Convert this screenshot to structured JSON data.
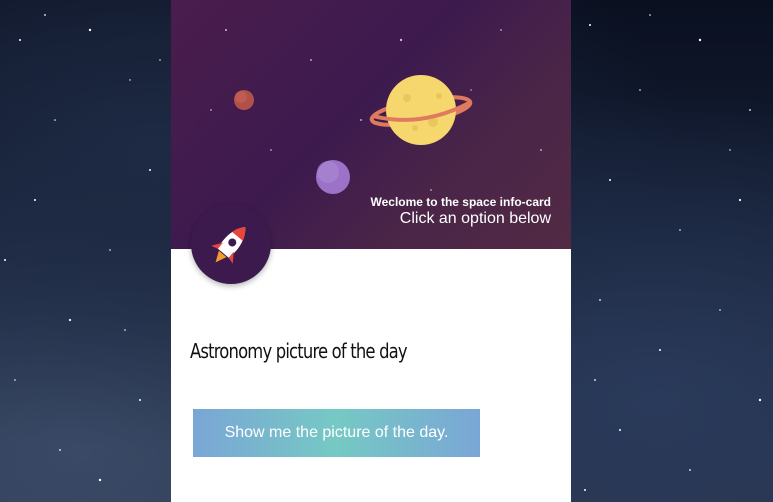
{
  "card": {
    "welcome": "Weclome to the space info-card",
    "subtitle": "Click an option below"
  },
  "section": {
    "title": "Astronomy picture of the day",
    "button_label": "Show me the picture of the day."
  },
  "colors": {
    "banner": "#3d1a4e",
    "button_gradient_start": "#7aa6d6",
    "button_gradient_mid": "#76c9c4",
    "planet": "#f5d76e",
    "ring": "#e07a5f"
  },
  "icons": {
    "avatar": "rocket-icon"
  }
}
